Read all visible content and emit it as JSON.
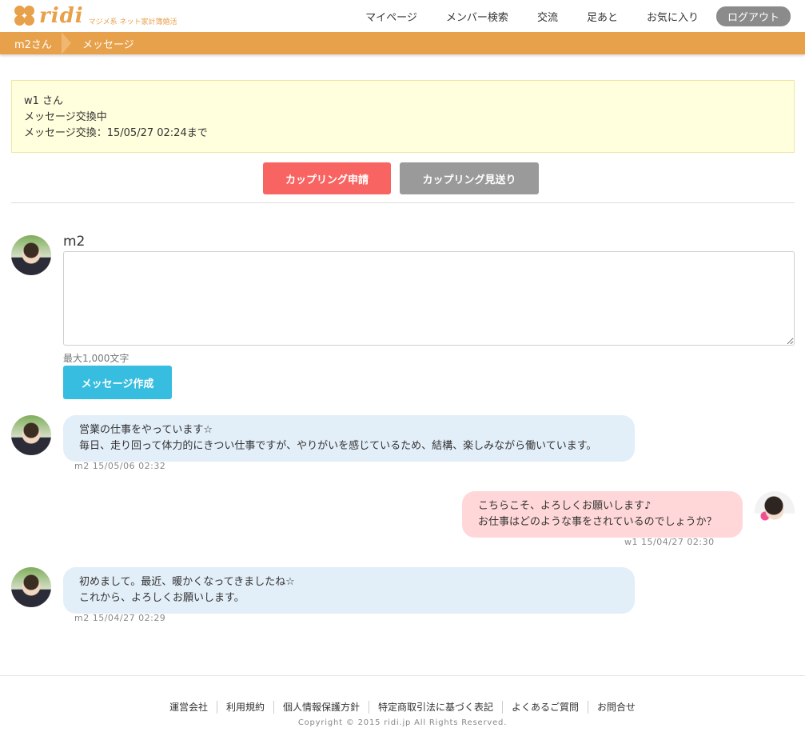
{
  "header": {
    "logo_text": "ridi",
    "logo_tagline": "マジメ系 ネット家計簿婚活",
    "nav": [
      "マイページ",
      "メンバー検索",
      "交流",
      "足あと",
      "お気に入り"
    ],
    "logout_label": "ログアウト"
  },
  "breadcrumb": {
    "items": [
      "m2さん",
      "メッセージ"
    ]
  },
  "status": {
    "partner": "w1 さん",
    "state": "メッセージ交換中",
    "deadline": "メッセージ交換：15/05/27 02:24まで"
  },
  "actions": {
    "apply_label": "カップリング申請",
    "pass_label": "カップリング見送り"
  },
  "composer": {
    "name": "m2",
    "value": "",
    "char_limit": "最大1,000文字",
    "submit_label": "メッセージ作成"
  },
  "messages": [
    {
      "sender": "m2",
      "line1": "営業の仕事をやっています☆",
      "line2": "毎日、走り回って体力的にきつい仕事ですが、やりがいを感じているため、結構、楽しみながら働いています。",
      "meta": "m2  15/05/06 02:32"
    },
    {
      "sender": "w1",
      "line1": "こちらこそ、よろしくお願いします♪",
      "line2": "お仕事はどのような事をされているのでしょうか？",
      "meta": "w1  15/04/27 02:30"
    },
    {
      "sender": "m2",
      "line1": "初めまして。最近、暖かくなってきましたね☆",
      "line2": "これから、よろしくお願いします。",
      "meta": "m2  15/04/27 02:29"
    }
  ],
  "footer": {
    "links": [
      "運営会社",
      "利用規約",
      "個人情報保護方針",
      "特定商取引法に基づく表記",
      "よくあるご質問",
      "お問合せ"
    ],
    "copyright": "Copyright © 2015 ridi.jp All Rights Reserved."
  },
  "colors": {
    "brand": "#e8a14b",
    "apply": "#f86461",
    "pass": "#9a9a9a",
    "create": "#36bde0",
    "bubble_m": "#e2eef8",
    "bubble_w": "#ffd7d8",
    "status_bg": "#ffffdd"
  }
}
